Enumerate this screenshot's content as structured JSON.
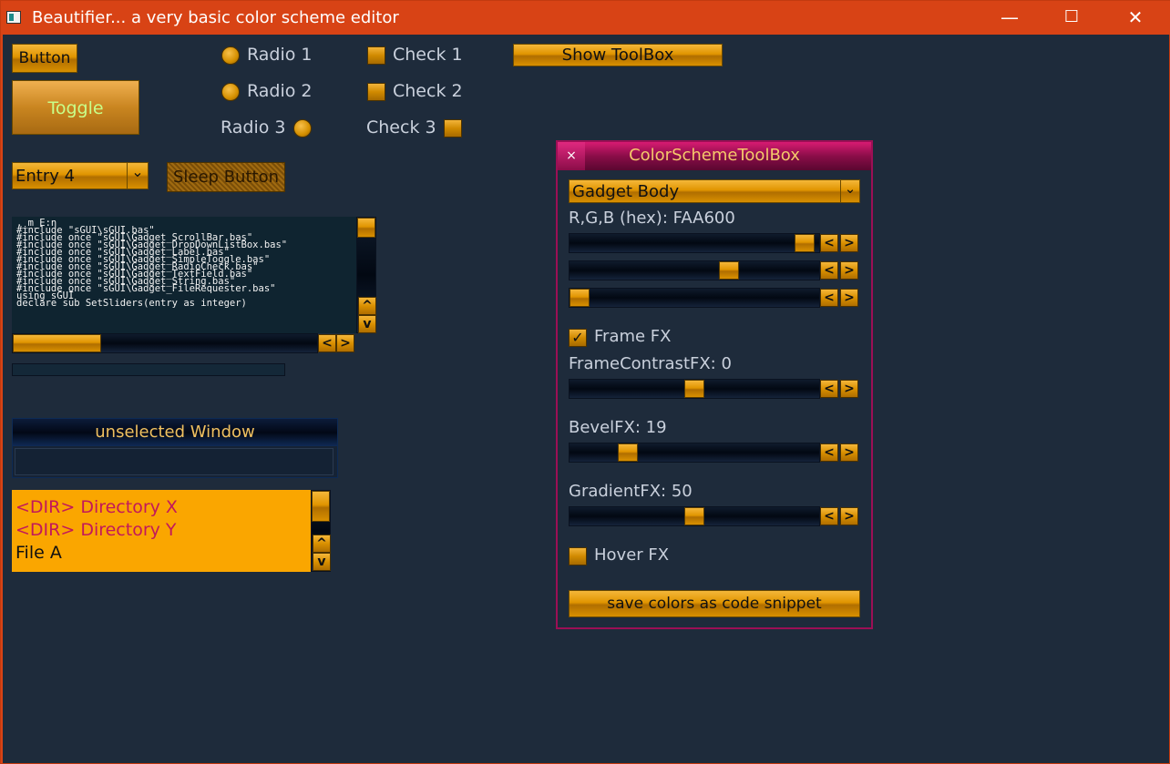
{
  "window": {
    "title": "Beautifier... a very basic color scheme editor",
    "controls": {
      "minimize": "—",
      "maximize": "☐",
      "close": "✕"
    }
  },
  "buttons": {
    "button": "Button",
    "toggle": "Toggle",
    "sleep": "Sleep Button",
    "show_toolbox": "Show ToolBox"
  },
  "radios": [
    {
      "label": "Radio 1",
      "checked": false
    },
    {
      "label": "Radio 2",
      "checked": false
    },
    {
      "label": "Radio 3",
      "checked": false
    }
  ],
  "checks": [
    {
      "label": "Check 1",
      "checked": false
    },
    {
      "label": "Check 2",
      "checked": false
    },
    {
      "label": "Check 3",
      "checked": false
    }
  ],
  "dropdown": {
    "selected": "Entry 4",
    "arrow": "⌄"
  },
  "code_editor": {
    "lines": [
      ",_m_E:n",
      "#include \"sGUI\\sGUI.bas\"",
      "#include once \"sGUI\\Gadget_ScrollBar.bas\"",
      "#include once \"sGUI\\Gadget_DropDownListBox.bas\"",
      "#include once \"sGUI\\Gadget_Label.bas\"",
      "#include once \"sGUI\\Gadget_SimpleToggle.bas\"",
      "#include once \"sGUI\\Gadget_RadioCheck.bas\"",
      "#include once \"sGUI\\Gadget_TextField.bas\"",
      "#include once \"sGUI\\Gadget_String.bas\"",
      "#include once \"sGUI\\Gadget_FileRequester.bas\"",
      "using sGUI",
      "",
      "declare sub SetSliders(entry as integer)"
    ]
  },
  "unselected_window": {
    "title": "unselected Window"
  },
  "file_list": [
    {
      "text": "<DIR> Directory X",
      "kind": "dir"
    },
    {
      "text": "<DIR> Directory Y",
      "kind": "dir"
    },
    {
      "text": "File A",
      "kind": "file"
    }
  ],
  "toolbox": {
    "title": "ColorSchemeToolBox",
    "close": "×",
    "target_dropdown": "Gadget Body",
    "rgb_label": "R,G,B (hex): FAA600",
    "rgb_sliders": [
      {
        "channel": "R",
        "value": 250,
        "max": 255
      },
      {
        "channel": "G",
        "value": 166,
        "max": 255
      },
      {
        "channel": "B",
        "value": 0,
        "max": 255
      }
    ],
    "frame_fx": {
      "label": "Frame FX",
      "checked": true,
      "mark": "✓"
    },
    "frame_contrast": {
      "label": "FrameContrastFX: 0",
      "fraction": 0.5
    },
    "bevel": {
      "label": "BevelFX: 19",
      "fraction": 0.21
    },
    "gradient": {
      "label": "GradientFX: 50",
      "fraction": 0.5
    },
    "hover_fx": {
      "label": "Hover FX",
      "checked": false
    },
    "save_button": "save colors as code snippet"
  },
  "arrows": {
    "left": "<",
    "right": ">",
    "up": "^",
    "down": "v"
  },
  "colors": {
    "title_bar": "#d84315",
    "background": "#1e2b3b",
    "gadget_body": "#faa600",
    "toolbox_frame": "#9c0f55",
    "dir_text": "#c2185b",
    "toggle_text": "#c8ff8a"
  }
}
